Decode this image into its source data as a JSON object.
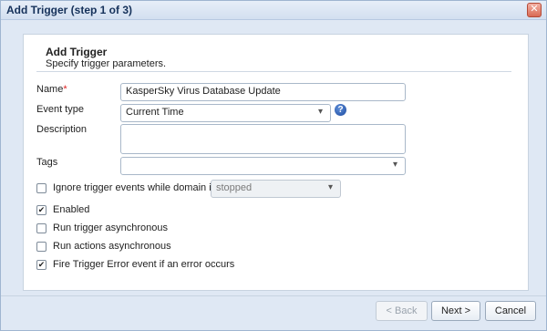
{
  "window": {
    "title": "Add Trigger (step 1 of 3)",
    "close_glyph": "✕"
  },
  "header": {
    "title": "Add Trigger",
    "subtitle": "Specify trigger parameters."
  },
  "form": {
    "name": {
      "label": "Name",
      "required_marker": "*",
      "value": "KasperSky Virus Database Update"
    },
    "event_type": {
      "label": "Event type",
      "value": "Current Time"
    },
    "description": {
      "label": "Description",
      "value": ""
    },
    "tags": {
      "label": "Tags",
      "value": ""
    },
    "ignore_events": {
      "label": "Ignore trigger events while domain is",
      "checked": false,
      "state_value": "stopped"
    },
    "enabled": {
      "label": "Enabled",
      "checked": true
    },
    "run_trigger_async": {
      "label": "Run trigger asynchronous",
      "checked": false
    },
    "run_actions_async": {
      "label": "Run actions asynchronous",
      "checked": false
    },
    "fire_error_event": {
      "label": "Fire Trigger Error event if an error occurs",
      "checked": true
    }
  },
  "icons": {
    "help": "?",
    "dropdown": "▾",
    "check": "✔"
  },
  "buttons": {
    "back": "< Back",
    "next": "Next >",
    "cancel": "Cancel"
  }
}
